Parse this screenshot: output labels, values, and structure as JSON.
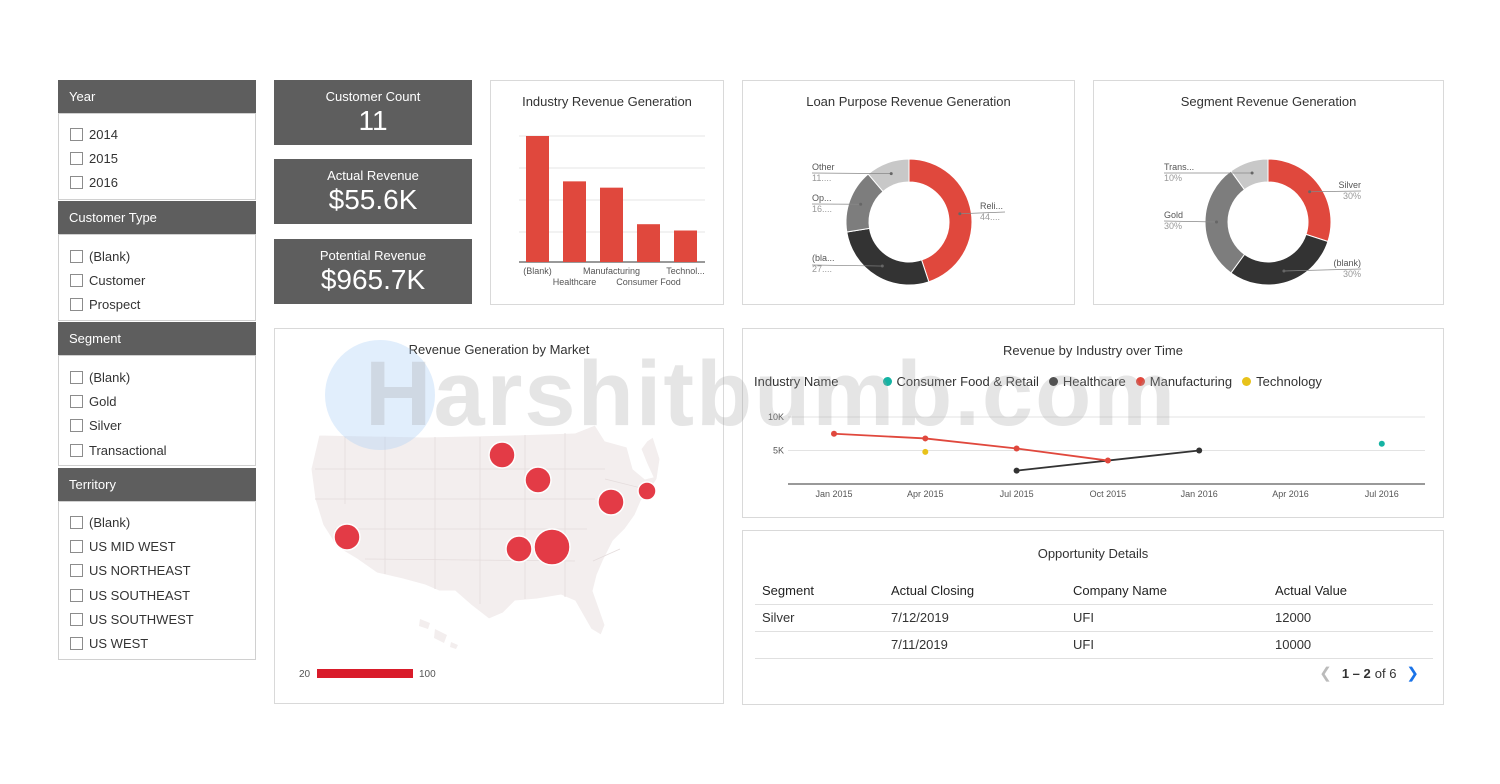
{
  "filters": [
    {
      "title": "Year",
      "items": [
        "2014",
        "2015",
        "2016"
      ]
    },
    {
      "title": "Customer Type",
      "items": [
        "(Blank)",
        "Customer",
        "Prospect"
      ]
    },
    {
      "title": "Segment",
      "items": [
        "(Blank)",
        "Gold",
        "Silver",
        "Transactional"
      ]
    },
    {
      "title": "Territory",
      "items": [
        "(Blank)",
        "US MID WEST",
        "US NORTHEAST",
        "US SOUTHEAST",
        "US SOUTHWEST",
        "US WEST"
      ]
    }
  ],
  "kpis": [
    {
      "label": "Customer Count",
      "value": "11"
    },
    {
      "label": "Actual Revenue",
      "value": "$55.6K"
    },
    {
      "label": "Potential Revenue",
      "value": "$965.7K"
    }
  ],
  "colors": {
    "accent": "#e0483d",
    "dark": "#333333",
    "teal": "#15b3a3",
    "yellow": "#e8c21a",
    "kpi_bg": "#5e5e5e",
    "map_fill": "#f3eeee"
  },
  "industry_chart": {
    "title": "Industry Revenue Generation",
    "chart_data": {
      "type": "bar",
      "categories": [
        "(Blank)",
        "Healthcare",
        "Manufacturing",
        "Consumer Food",
        "Technol..."
      ],
      "values": [
        100,
        64,
        59,
        30,
        25
      ]
    }
  },
  "loan_chart": {
    "title": "Loan Purpose Revenue Generation",
    "chart_data": {
      "type": "pie",
      "slices": [
        {
          "label": "Reli...",
          "sub": "44....",
          "value": 44,
          "color": "#e0483d"
        },
        {
          "label": "(bla...",
          "sub": "27....",
          "value": 27,
          "color": "#333333"
        },
        {
          "label": "Op...",
          "sub": "16....",
          "value": 16,
          "color": "#7d7d7d"
        },
        {
          "label": "Other",
          "sub": "11....",
          "value": 11,
          "color": "#c8c8c8"
        }
      ]
    }
  },
  "segment_chart": {
    "title": "Segment Revenue Generation",
    "chart_data": {
      "type": "pie",
      "slices": [
        {
          "label": "Silver",
          "sub": "30%",
          "value": 30,
          "color": "#e0483d"
        },
        {
          "label": "(blank)",
          "sub": "30%",
          "value": 30,
          "color": "#333333"
        },
        {
          "label": "Gold",
          "sub": "30%",
          "value": 30,
          "color": "#7d7d7d"
        },
        {
          "label": "Trans...",
          "sub": "10%",
          "value": 10,
          "color": "#c8c8c8"
        }
      ]
    }
  },
  "map": {
    "title": "Revenue Generation by Market",
    "legend_min": "20",
    "legend_max": "100"
  },
  "line_chart": {
    "title": "Revenue by Industry over Time",
    "legend_title": "Industry Name",
    "chart_data": {
      "type": "line",
      "x_ticks": [
        "Jan 2015",
        "Apr 2015",
        "Jul 2015",
        "Oct 2015",
        "Jan 2016",
        "Apr 2016",
        "Jul 2016"
      ],
      "y_ticks": [
        "10K",
        "5K"
      ],
      "ylim": [
        0,
        10000
      ],
      "series": [
        {
          "name": "Consumer Food & Retail",
          "color": "#15b3a3",
          "points": [
            [
              6,
              6000
            ]
          ]
        },
        {
          "name": "Healthcare",
          "color": "#333333",
          "points": [
            [
              2,
              2000
            ],
            [
              4,
              5000
            ]
          ]
        },
        {
          "name": "Manufacturing",
          "color": "#e0483d",
          "points": [
            [
              0,
              7500
            ],
            [
              1,
              6800
            ],
            [
              2,
              5300
            ],
            [
              3,
              3500
            ]
          ]
        },
        {
          "name": "Technology",
          "color": "#e8c21a",
          "points": [
            [
              1,
              4800
            ]
          ]
        }
      ]
    }
  },
  "opportunity": {
    "title": "Opportunity Details",
    "headers": [
      "Segment",
      "Actual Closing",
      "Company Name",
      "Actual Value"
    ],
    "rows": [
      [
        "Silver",
        "7/12/2019",
        "UFI",
        "12000"
      ],
      [
        "",
        "7/11/2019",
        "UFI",
        "10000"
      ]
    ],
    "pagination_range": "1 – 2",
    "pagination_total": "of 6"
  },
  "watermark": "Harshitbumb.com"
}
